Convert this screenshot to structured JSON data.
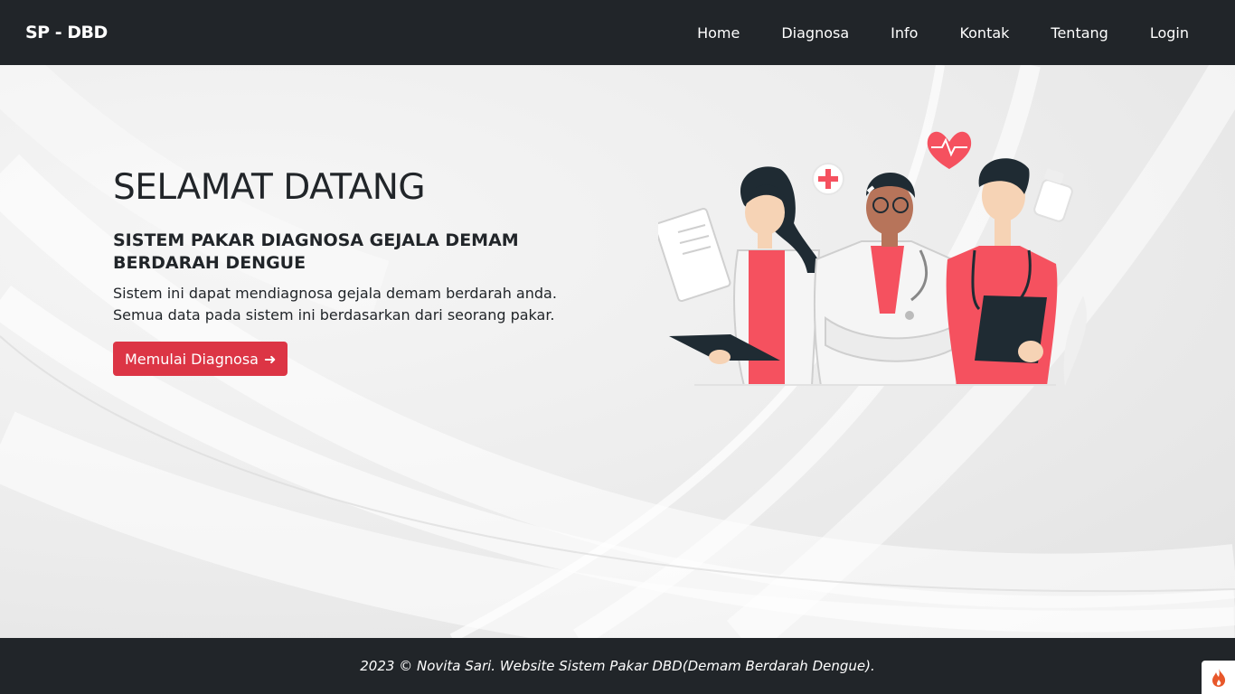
{
  "navbar": {
    "brand": "SP - DBD",
    "links": [
      "Home",
      "Diagnosa",
      "Info",
      "Kontak",
      "Tentang",
      "Login"
    ]
  },
  "hero": {
    "title": "SELAMAT DATANG",
    "subtitle": "SISTEM PAKAR DIAGNOSA GEJALA DEMAM BERDARAH DENGUE",
    "description_line1": "Sistem ini dapat mendiagnosa gejala demam berdarah anda.",
    "description_line2": "Semua data pada sistem ini berdasarkan dari seorang pakar.",
    "button_label": "Memulai Diagnosa",
    "button_arrow": "➜",
    "illustration": "doctors-illustration"
  },
  "footer": {
    "text": "2023 © Novita Sari. Website Sistem Pakar DBD(Demam Berdarah Dengue)."
  },
  "floating_button": {
    "icon": "flame-icon"
  },
  "colors": {
    "navbar_bg": "#212529",
    "accent": "#dc3545",
    "illustration_red": "#f5515f",
    "text": "#212529"
  }
}
